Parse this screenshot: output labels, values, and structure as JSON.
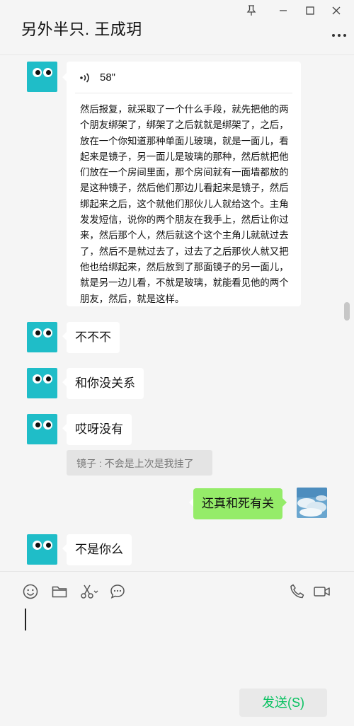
{
  "window": {
    "title": "另外半只. 王成玥"
  },
  "messages": {
    "voice": {
      "duration": "58\"",
      "transcript": "然后报复，就采取了一个什么手段，就先把他的两个朋友绑架了，绑架了之后就就是绑架了，之后，放在一个你知道那种单面儿玻璃，就是一面儿，看起来是镜子，另一面儿是玻璃的那种，然后就把他们放在一个房间里面，那个房间就有一面墙都放的是这种镜子，然后他们那边儿看起来是镜子，然后绑起来之后，这个就他们那伙儿人就给这个。主角发发短信，说你的两个朋友在我手上，然后让你过来，然后那个人，然后就这个这个主角儿就就过去了，然后不是就过去了，过去了之后那伙人就又把他也给绑起来，然后放到了那面镜子的另一面儿，就是另一边儿看，不就是玻璃，就能看见他的两个朋友，然后，就是这样。"
    },
    "m1": "不不不",
    "m2": "和你没关系",
    "m3": "哎呀没有",
    "quote": "镜子 : 不会是上次是我挂了",
    "mine": "还真和死有关",
    "m4": "不是你么"
  },
  "input": {
    "send_label": "发送(S)"
  },
  "colors": {
    "avatar_bg": "#1fbdc8",
    "my_bubble": "#95ec69",
    "send_text": "#07c160"
  },
  "icons": [
    "pin-icon",
    "minimize-icon",
    "maximize-icon",
    "close-icon",
    "more-icon",
    "voice-icon",
    "emoji-icon",
    "folder-icon",
    "scissors-icon",
    "chat-bubble-icon",
    "phone-icon",
    "video-icon"
  ]
}
